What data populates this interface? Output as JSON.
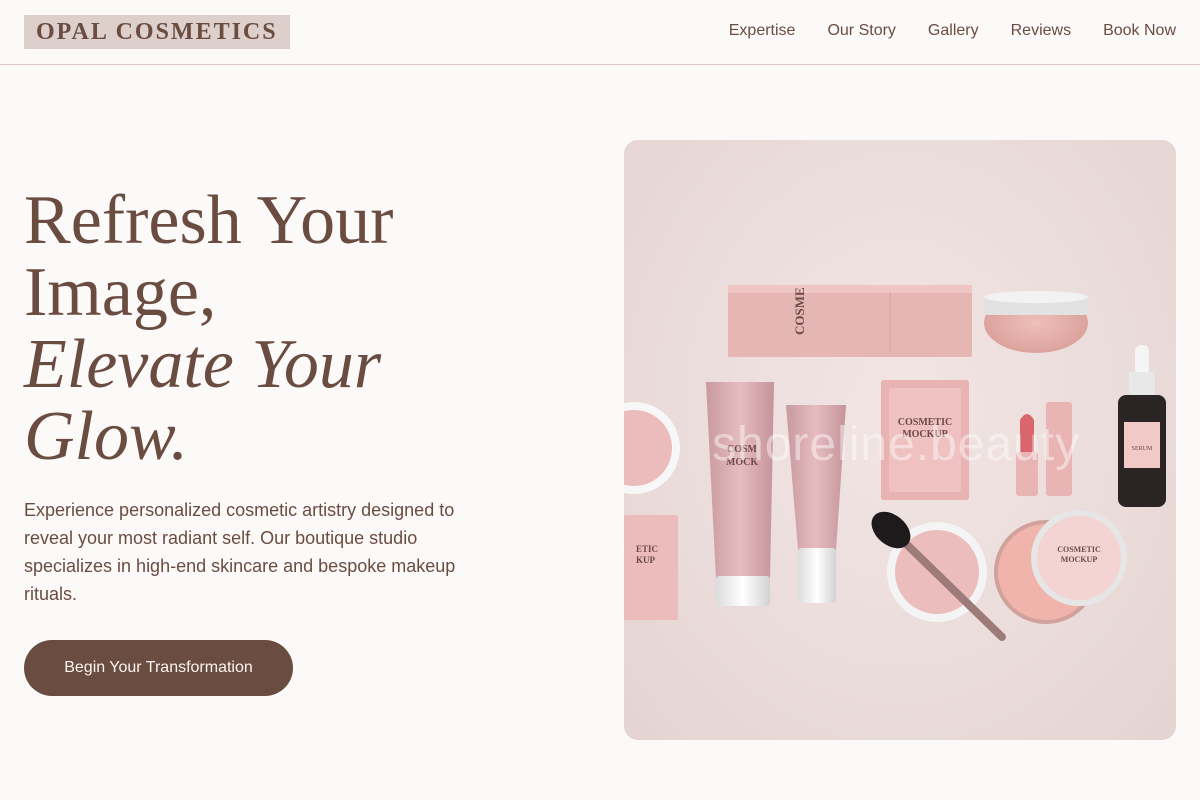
{
  "brand": {
    "name": "OPAL COSMETICS"
  },
  "nav": {
    "items": [
      {
        "label": "Expertise"
      },
      {
        "label": "Our Story"
      },
      {
        "label": "Gallery"
      },
      {
        "label": "Reviews"
      },
      {
        "label": "Book Now"
      }
    ]
  },
  "hero": {
    "title_line1": "Refresh Your",
    "title_line2": "Image,",
    "title_line3": "Elevate Your",
    "title_line4": "Glow.",
    "description": "Experience personalized cosmetic artistry designed to reveal your most radiant self. Our boutique studio specializes in high-end skincare and bespoke makeup rituals.",
    "cta_label": "Begin Your Transformation"
  },
  "image": {
    "watermark": "shoreline.beauty",
    "box_label_1": "COSMETIC",
    "box_label_2": "MOCKUP"
  },
  "colors": {
    "text": "#6b4c41",
    "accent": "#6b4c41",
    "background": "#fcf9f9",
    "logo_background": "#dccfcc",
    "product_pink": "#e3b5b5"
  }
}
